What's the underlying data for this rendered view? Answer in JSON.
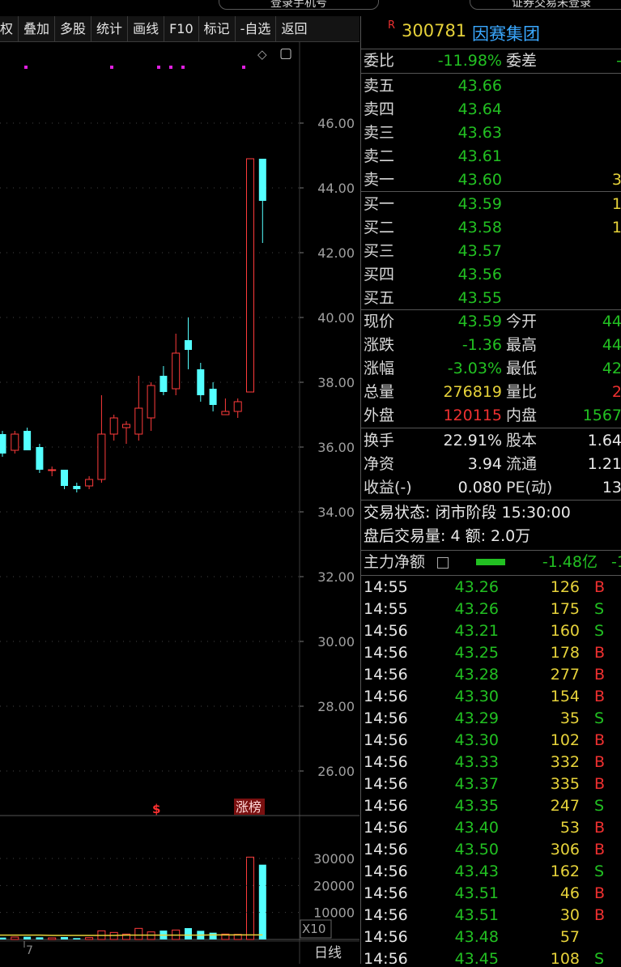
{
  "top": {
    "left_pill": "登录手机号",
    "right_pill": "证券交易未登录"
  },
  "toolbar": [
    "权",
    "叠加",
    "多股",
    "统计",
    "画线",
    "F10",
    "标记",
    "-自选",
    "返回"
  ],
  "chart_icons": {
    "diamond": "◇",
    "window": "▢"
  },
  "chart_data": {
    "type": "candlestick",
    "title": "",
    "price_ticks": [
      "46.00",
      "44.00",
      "42.00",
      "40.00",
      "38.00",
      "36.00",
      "34.00",
      "32.00",
      "30.00",
      "28.00",
      "26.00"
    ],
    "price_tick_values": [
      46,
      44,
      42,
      40,
      38,
      36,
      34,
      32,
      30,
      28,
      26
    ],
    "volume_ticks": [
      "30000",
      "20000",
      "10000"
    ],
    "volume_tick_values": [
      30000,
      20000,
      10000
    ],
    "volume_unit": "X10",
    "period_label": "日线",
    "x_tick": "7",
    "marker_s": "$",
    "marker_rank": "涨榜",
    "candles": [
      {
        "o": 36.4,
        "h": 36.5,
        "l": 35.7,
        "c": 35.8,
        "v": 700
      },
      {
        "o": 35.9,
        "h": 36.5,
        "l": 35.8,
        "c": 36.4,
        "v": 900
      },
      {
        "o": 36.5,
        "h": 36.6,
        "l": 35.9,
        "c": 35.9,
        "v": 1000
      },
      {
        "o": 36.0,
        "h": 36.1,
        "l": 35.2,
        "c": 35.3,
        "v": 800
      },
      {
        "o": 35.3,
        "h": 35.4,
        "l": 35.1,
        "c": 35.3,
        "v": 600
      },
      {
        "o": 35.3,
        "h": 35.3,
        "l": 34.7,
        "c": 34.8,
        "v": 900
      },
      {
        "o": 34.8,
        "h": 34.9,
        "l": 34.6,
        "c": 34.7,
        "v": 500
      },
      {
        "o": 34.8,
        "h": 35.1,
        "l": 34.7,
        "c": 35.0,
        "v": 700
      },
      {
        "o": 35.0,
        "h": 37.6,
        "l": 34.9,
        "c": 36.4,
        "v": 3200
      },
      {
        "o": 36.4,
        "h": 37.0,
        "l": 36.2,
        "c": 36.9,
        "v": 2600
      },
      {
        "o": 36.6,
        "h": 36.8,
        "l": 36.1,
        "c": 36.7,
        "v": 2000
      },
      {
        "o": 36.4,
        "h": 38.2,
        "l": 36.2,
        "c": 37.2,
        "v": 4100
      },
      {
        "o": 36.9,
        "h": 38.0,
        "l": 36.5,
        "c": 37.9,
        "v": 2800
      },
      {
        "o": 38.2,
        "h": 38.5,
        "l": 37.6,
        "c": 37.7,
        "v": 3300
      },
      {
        "o": 37.8,
        "h": 39.5,
        "l": 37.6,
        "c": 38.9,
        "v": 3500
      },
      {
        "o": 39.3,
        "h": 40.0,
        "l": 38.4,
        "c": 39.0,
        "v": 4200
      },
      {
        "o": 38.4,
        "h": 38.6,
        "l": 37.4,
        "c": 37.6,
        "v": 3200
      },
      {
        "o": 37.8,
        "h": 38.0,
        "l": 37.1,
        "c": 37.3,
        "v": 2500
      },
      {
        "o": 37.0,
        "h": 37.5,
        "l": 37.0,
        "c": 37.1,
        "v": 2000
      },
      {
        "o": 37.1,
        "h": 37.5,
        "l": 36.9,
        "c": 37.4,
        "v": 1900
      },
      {
        "o": 37.7,
        "h": 44.9,
        "l": 37.7,
        "c": 44.9,
        "v": 30500
      },
      {
        "o": 44.9,
        "h": 44.9,
        "l": 42.3,
        "c": 43.6,
        "v": 27700
      }
    ],
    "volume_ma": [
      1600,
      1600,
      1600,
      1600,
      1500,
      1500,
      1500,
      1500,
      1500,
      1500,
      1600,
      1600,
      1600,
      1600,
      1600,
      1600,
      1600,
      1700,
      1700,
      1700,
      1700,
      1700
    ]
  },
  "header": {
    "badge": "R",
    "code": "300781",
    "name": "因赛集团"
  },
  "order": {
    "weibi_label": "委比",
    "weibi_value": "-11.98%",
    "weicha_label": "委差",
    "weicha_value": "-",
    "asks": [
      {
        "label": "卖五",
        "price": "43.66",
        "vol": ""
      },
      {
        "label": "卖四",
        "price": "43.64",
        "vol": ""
      },
      {
        "label": "卖三",
        "price": "43.63",
        "vol": ""
      },
      {
        "label": "卖二",
        "price": "43.61",
        "vol": ""
      },
      {
        "label": "卖一",
        "price": "43.60",
        "vol": "3"
      }
    ],
    "bids": [
      {
        "label": "买一",
        "price": "43.59",
        "vol": "1"
      },
      {
        "label": "买二",
        "price": "43.58",
        "vol": "1"
      },
      {
        "label": "买三",
        "price": "43.57",
        "vol": ""
      },
      {
        "label": "买四",
        "price": "43.56",
        "vol": ""
      },
      {
        "label": "买五",
        "price": "43.55",
        "vol": ""
      }
    ]
  },
  "quote": [
    {
      "l1": "现价",
      "v1": "43.59",
      "c1": "green",
      "l2": "今开",
      "v2": "44",
      "c2": "green"
    },
    {
      "l1": "涨跌",
      "v1": "-1.36",
      "c1": "green",
      "l2": "最高",
      "v2": "44",
      "c2": "green"
    },
    {
      "l1": "涨幅",
      "v1": "-3.03%",
      "c1": "green",
      "l2": "最低",
      "v2": "42",
      "c2": "green"
    },
    {
      "l1": "总量",
      "v1": "276819",
      "c1": "yellow",
      "l2": "量比",
      "v2": "2",
      "c2": "red"
    },
    {
      "l1": "外盘",
      "v1": "120115",
      "c1": "red",
      "l2": "内盘",
      "v2": "1567",
      "c2": "green"
    }
  ],
  "fund": [
    {
      "l1": "换手",
      "v1": "22.91%",
      "l2": "股本",
      "v2": "1.64"
    },
    {
      "l1": "净资",
      "v1": "3.94",
      "l2": "流通",
      "v2": "1.21"
    },
    {
      "l1": "收益(-)",
      "v1": "0.080",
      "l2": "PE(动)",
      "v2": "13"
    }
  ],
  "status": {
    "line1": "交易状态: 闭市阶段 15:30:00",
    "line2": "盘后交易量: 4  额: 2.0万"
  },
  "mainflow": {
    "label": "主力净额",
    "value": "-1.48亿",
    "value2": "-1"
  },
  "ticks": [
    {
      "t": "14:55",
      "p": "43.26",
      "v": "126",
      "d": "B"
    },
    {
      "t": "14:55",
      "p": "43.26",
      "v": "175",
      "d": "S"
    },
    {
      "t": "14:56",
      "p": "43.21",
      "v": "160",
      "d": "S"
    },
    {
      "t": "14:56",
      "p": "43.25",
      "v": "178",
      "d": "B"
    },
    {
      "t": "14:56",
      "p": "43.28",
      "v": "277",
      "d": "B"
    },
    {
      "t": "14:56",
      "p": "43.30",
      "v": "154",
      "d": "B"
    },
    {
      "t": "14:56",
      "p": "43.29",
      "v": "35",
      "d": "S"
    },
    {
      "t": "14:56",
      "p": "43.30",
      "v": "102",
      "d": "B"
    },
    {
      "t": "14:56",
      "p": "43.33",
      "v": "332",
      "d": "B"
    },
    {
      "t": "14:56",
      "p": "43.37",
      "v": "335",
      "d": "B"
    },
    {
      "t": "14:56",
      "p": "43.35",
      "v": "247",
      "d": "S"
    },
    {
      "t": "14:56",
      "p": "43.40",
      "v": "53",
      "d": "B"
    },
    {
      "t": "14:56",
      "p": "43.50",
      "v": "306",
      "d": "B"
    },
    {
      "t": "14:56",
      "p": "43.43",
      "v": "162",
      "d": "S"
    },
    {
      "t": "14:56",
      "p": "43.51",
      "v": "46",
      "d": "B"
    },
    {
      "t": "14:56",
      "p": "43.51",
      "v": "30",
      "d": "B"
    },
    {
      "t": "14:56",
      "p": "43.48",
      "v": "57",
      "d": ""
    },
    {
      "t": "14:56",
      "p": "43.45",
      "v": "108",
      "d": "S"
    }
  ]
}
